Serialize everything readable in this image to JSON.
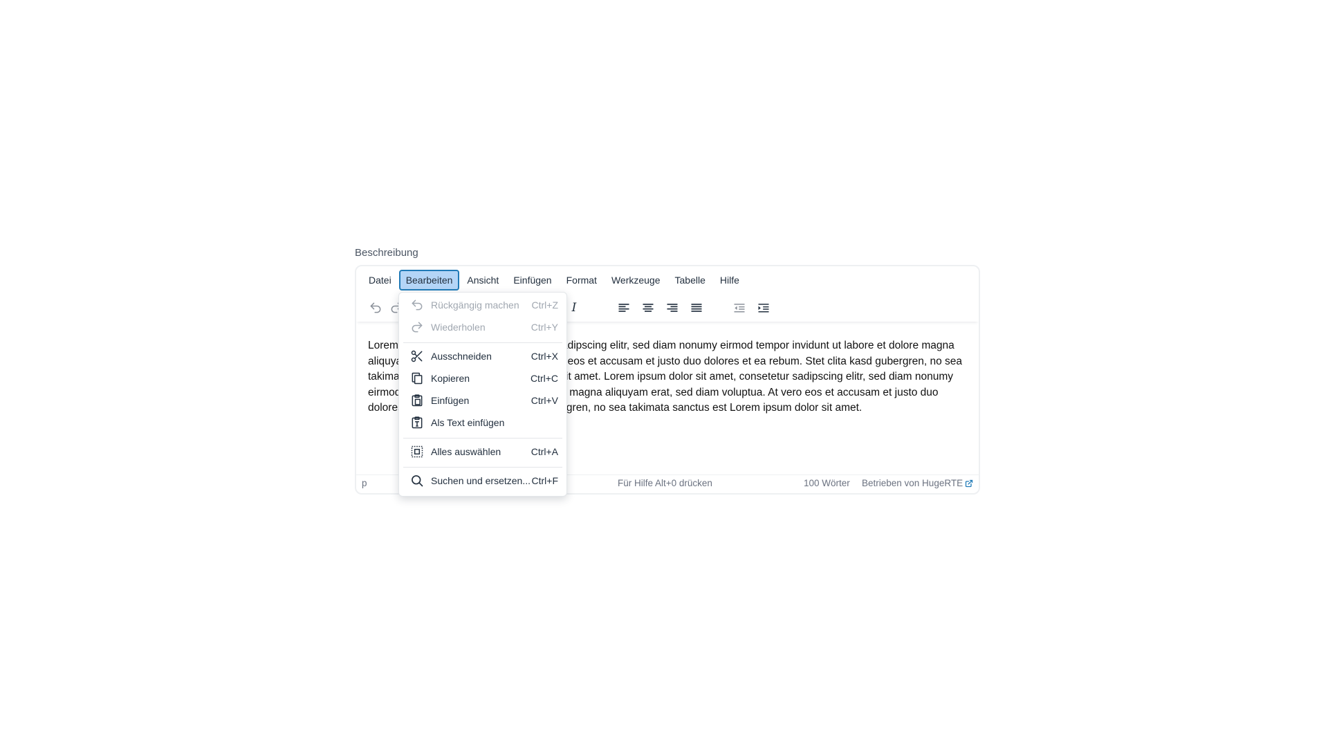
{
  "field": {
    "label": "Beschreibung"
  },
  "menubar": {
    "items": [
      "Datei",
      "Bearbeiten",
      "Ansicht",
      "Einfügen",
      "Format",
      "Werkzeuge",
      "Tabelle",
      "Hilfe"
    ],
    "active_index": 1
  },
  "toolbar": {
    "italic_label": "I",
    "icons": [
      "undo-icon",
      "redo-icon",
      "italic-icon",
      "align-left-icon",
      "align-center-icon",
      "align-right-icon",
      "justify-icon",
      "outdent-icon",
      "indent-icon"
    ]
  },
  "content": {
    "text": "Lorem ipsum dolor sit amet, consetetur sadipscing elitr, sed diam nonumy eirmod tempor invidunt ut labore et dolore magna aliquyam erat, sed diam voluptua. At vero eos et accusam et justo duo dolores et ea rebum. Stet clita kasd gubergren, no sea takimata sanctus est Lorem ipsum dolor sit amet. Lorem ipsum dolor sit amet, consetetur sadipscing elitr, sed diam nonumy eirmod tempor invidunt ut labore et dolore magna aliquyam erat, sed diam voluptua. At vero eos et accusam et justo duo dolores et ea rebum. Stet clita kasd gubergren, no sea takimata sanctus est Lorem ipsum dolor sit amet."
  },
  "statusbar": {
    "path": "p",
    "help": "Für Hilfe Alt+0 drücken",
    "word_count": "100 Wörter",
    "brand": "Betrieben von HugeRTE"
  },
  "dropdown": {
    "items": [
      {
        "label": "Rückgängig machen",
        "shortcut": "Ctrl+Z",
        "icon": "undo-icon",
        "disabled": true
      },
      {
        "label": "Wiederholen",
        "shortcut": "Ctrl+Y",
        "icon": "redo-icon",
        "disabled": true
      },
      {
        "label": "Ausschneiden",
        "shortcut": "Ctrl+X",
        "icon": "scissors-icon",
        "disabled": false
      },
      {
        "label": "Kopieren",
        "shortcut": "Ctrl+C",
        "icon": "copy-icon",
        "disabled": false
      },
      {
        "label": "Einfügen",
        "shortcut": "Ctrl+V",
        "icon": "paste-icon",
        "disabled": false
      },
      {
        "label": "Als Text einfügen",
        "shortcut": "",
        "icon": "paste-text-icon",
        "disabled": false
      },
      {
        "label": "Alles auswählen",
        "shortcut": "Ctrl+A",
        "icon": "select-all-icon",
        "disabled": false
      },
      {
        "label": "Suchen und ersetzen...",
        "shortcut": "Ctrl+F",
        "icon": "search-icon",
        "disabled": false
      }
    ]
  },
  "colors": {
    "active_menu_bg": "#b4d5f7",
    "active_menu_border": "#207ab7",
    "link": "#207ab7",
    "text": "#222f3e"
  }
}
